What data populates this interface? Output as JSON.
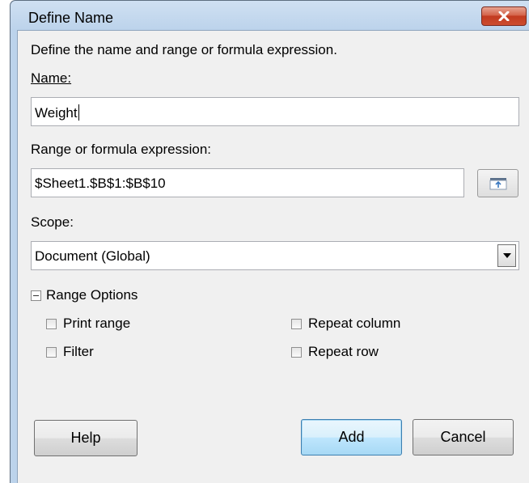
{
  "dialog": {
    "title": "Define Name",
    "description": "Define the name and range or formula expression."
  },
  "name": {
    "label": "Name:",
    "value": "Weight"
  },
  "range": {
    "label": "Range or formula expression:",
    "value": "$Sheet1.$B$1:$B$10"
  },
  "scope": {
    "label": "Scope:",
    "selected": "Document (Global)"
  },
  "range_options": {
    "label": "Range Options",
    "print_range": {
      "label": "Print range",
      "checked": false
    },
    "filter": {
      "label": "Filter",
      "checked": false
    },
    "repeat_column": {
      "label": "Repeat column",
      "checked": false
    },
    "repeat_row": {
      "label": "Repeat row",
      "checked": false
    }
  },
  "buttons": {
    "help": "Help",
    "add": "Add",
    "cancel": "Cancel"
  },
  "icons": {
    "close": "close-icon",
    "shrink": "shrink-dialog-icon",
    "dropdown": "chevron-down-icon",
    "collapse": "collapse-icon"
  }
}
